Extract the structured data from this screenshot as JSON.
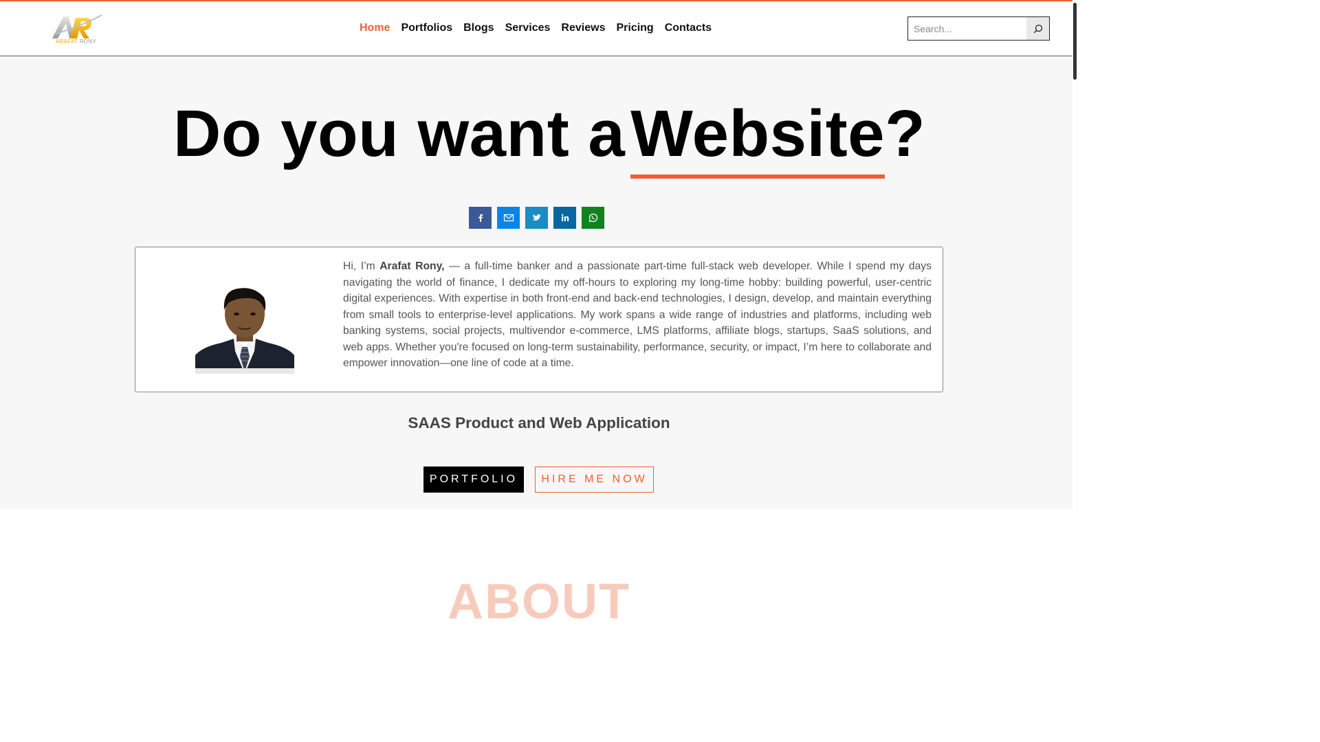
{
  "brand": {
    "logo_text": "ARAFAT",
    "logo_text2": "RONY",
    "accent": "#ee5f33"
  },
  "nav": {
    "items": [
      "Home",
      "Portfolios",
      "Blogs",
      "Services",
      "Reviews",
      "Pricing",
      "Contacts"
    ],
    "active": "Home"
  },
  "search": {
    "placeholder": "Search...",
    "icon": "search-icon"
  },
  "hero": {
    "headline_prefix": "Do you want a",
    "headline_highlight": "Website",
    "headline_suffix": "?",
    "share_icons": [
      "facebook-icon",
      "email-icon",
      "twitter-icon",
      "linkedin-icon",
      "whatsapp-icon"
    ],
    "share_colors": [
      "#3b5998",
      "#0a85e6",
      "#1b8bc6",
      "#0a66a0",
      "#12821e"
    ]
  },
  "bio": {
    "intro": "Hi, I’m ",
    "name": "Arafat Rony,",
    "text": " — a full-time banker and a passionate part-time full-stack web developer. While I spend my days navigating the world of finance, I dedicate my off-hours to exploring my long-time hobby: building powerful, user-centric digital experiences. With expertise in both front-end and back-end technologies, I design, develop, and maintain everything from small tools to enterprise-level applications. My work spans a wide range of industries and platforms, including web banking systems, social projects, multivendor e-commerce, LMS platforms, affiliate blogs, startups, SaaS solutions, and web apps. Whether you're focused on long-term sustainability, performance, security, or impact, I’m here to collaborate and empower innovation—one line of code at a time."
  },
  "tagline": "SAAS Product and Web Application",
  "buttons": {
    "portfolio": "PORTFOLIO",
    "hire": "HIRE ME NOW"
  },
  "about_heading": "ABOUT"
}
